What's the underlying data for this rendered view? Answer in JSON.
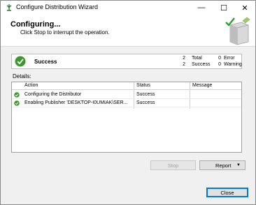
{
  "window": {
    "title": "Configure Distribution Wizard",
    "controls": {
      "minimize": "—",
      "maximize": "☐",
      "close": "✕"
    }
  },
  "header": {
    "title": "Configuring...",
    "subtitle": "Click Stop to interrupt the operation."
  },
  "summary": {
    "status": "Success",
    "stats": {
      "total_count": "2",
      "total_label": "Total",
      "error_count": "0",
      "error_label": "Error",
      "success_count": "2",
      "success_label": "Success",
      "warning_count": "0",
      "warning_label": "Warning"
    }
  },
  "details": {
    "label": "Details:",
    "columns": {
      "action": "Action",
      "status": "Status",
      "message": "Message"
    },
    "rows": [
      {
        "action": "Configuring the Distributor",
        "status": "Success",
        "message": ""
      },
      {
        "action": "Enabling Publisher 'DESKTOP-I0UMIAK\\SER...",
        "status": "Success",
        "message": ""
      }
    ]
  },
  "buttons": {
    "stop": "Stop",
    "report": "Report",
    "close": "Close"
  },
  "colors": {
    "success_green": "#3c9a2c",
    "accent_blue": "#0078d7"
  }
}
